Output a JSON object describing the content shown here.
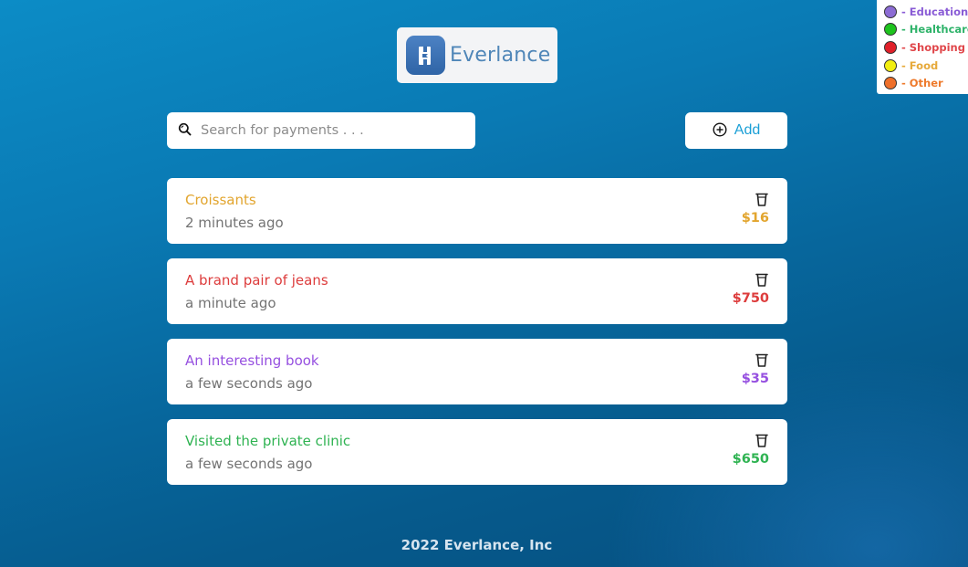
{
  "legend": [
    {
      "label": "- Education",
      "color": "#8a5cd6",
      "dot": "#8c6cd4"
    },
    {
      "label": "- Healthcare",
      "color": "#2fb36a",
      "dot": "#1ec31e"
    },
    {
      "label": "- Shopping",
      "color": "#e0464a",
      "dot": "#e0202a"
    },
    {
      "label": "- Food",
      "color": "#e6a93a",
      "dot": "#f2ee10"
    },
    {
      "label": "- Other",
      "color": "#ee7a2c",
      "dot": "#ee6f2a"
    }
  ],
  "logo": {
    "text": "Everlance",
    "icon": "everlance-logo-icon"
  },
  "search": {
    "placeholder": "Search for payments . . .",
    "icon": "search-icon"
  },
  "add_button": {
    "label": "Add",
    "icon": "plus-circle-icon"
  },
  "payments": [
    {
      "title": "Croissants",
      "time": "2 minutes ago",
      "amount": "$16",
      "color": "#e2a52e"
    },
    {
      "title": "A brand pair of jeans",
      "time": "a minute ago",
      "amount": "$750",
      "color": "#dd3c3c"
    },
    {
      "title": "An interesting book",
      "time": "a few seconds ago",
      "amount": "$35",
      "color": "#9650e0"
    },
    {
      "title": "Visited the private clinic",
      "time": "a few seconds ago",
      "amount": "$650",
      "color": "#2fb352"
    }
  ],
  "footer": {
    "text": "2022 Everlance, Inc"
  }
}
